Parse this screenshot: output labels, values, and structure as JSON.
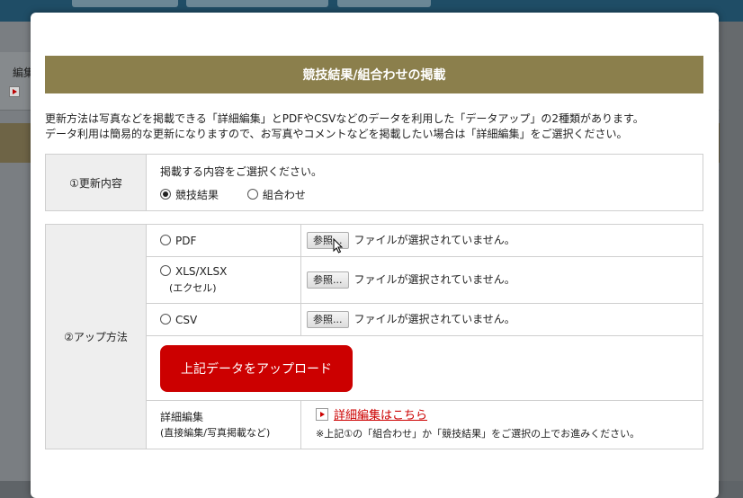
{
  "background": {
    "left_text": "編集"
  },
  "modal": {
    "title": "競技結果/組合わせの掲載",
    "intro_line1": "更新方法は写真などを掲載できる「詳細編集」とPDFやCSVなどのデータを利用した「データアップ」の2種類があります。",
    "intro_line2": "データ利用は簡易的な更新になりますので、お写真やコメントなどを掲載したい場合は「詳細編集」をご選択ください。"
  },
  "content_section": {
    "header": "①更新内容",
    "prompt": "掲載する内容をご選択ください。",
    "options": [
      {
        "label": "競技結果",
        "checked": true
      },
      {
        "label": "組合わせ",
        "checked": false
      }
    ]
  },
  "upload_section": {
    "header": "②アップ方法",
    "browse_label": "参照...",
    "no_file_text": "ファイルが選択されていません。",
    "formats": [
      {
        "label": "PDF",
        "sub": ""
      },
      {
        "label": "XLS/XLSX",
        "sub": "(エクセル)"
      },
      {
        "label": "CSV",
        "sub": ""
      }
    ],
    "upload_button": "上記データをアップロード",
    "detail_label": "詳細編集",
    "detail_sub": "(直接編集/写真掲載など)",
    "detail_link": "詳細編集はこちら",
    "detail_note": "※上記①の「組合わせ」か「競技結果」をご選択の上でお進みください。"
  },
  "colors": {
    "title_bar": "#8b7f4c",
    "upload_button": "#cc0000",
    "link": "#cc0000"
  }
}
